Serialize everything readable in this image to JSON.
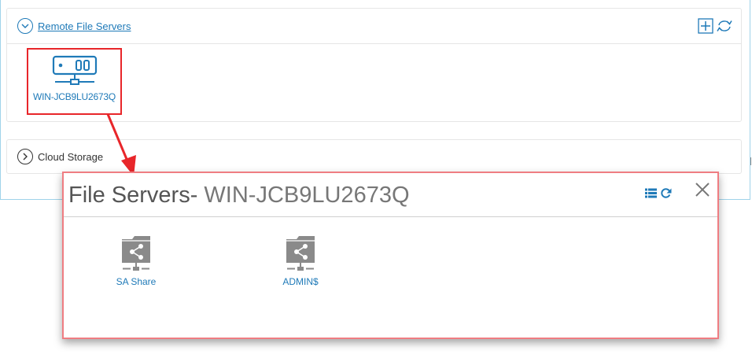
{
  "remote_section": {
    "title": "Remote File Servers",
    "servers": [
      {
        "name": "WIN-JCB9LU2673Q",
        "icon": "server-icon"
      }
    ],
    "tools": [
      "add-icon",
      "refresh-icon"
    ]
  },
  "cloud_section": {
    "title": "Cloud Storage"
  },
  "modal": {
    "title_prefix": "File Servers- ",
    "server_name": "WIN-JCB9LU2673Q",
    "tools": [
      "list-view-icon",
      "refresh-icon",
      "close-icon"
    ],
    "shares": [
      {
        "name": "SA Share",
        "icon": "shared-folder-icon"
      },
      {
        "name": "ADMIN$",
        "icon": "shared-folder-icon"
      }
    ]
  },
  "colors": {
    "link": "#1f7ab8",
    "highlight_border": "#e8262a",
    "modal_border": "#ef7d82",
    "outer_border": "#9fd3ea",
    "share_icon": "#8a8a8a"
  }
}
